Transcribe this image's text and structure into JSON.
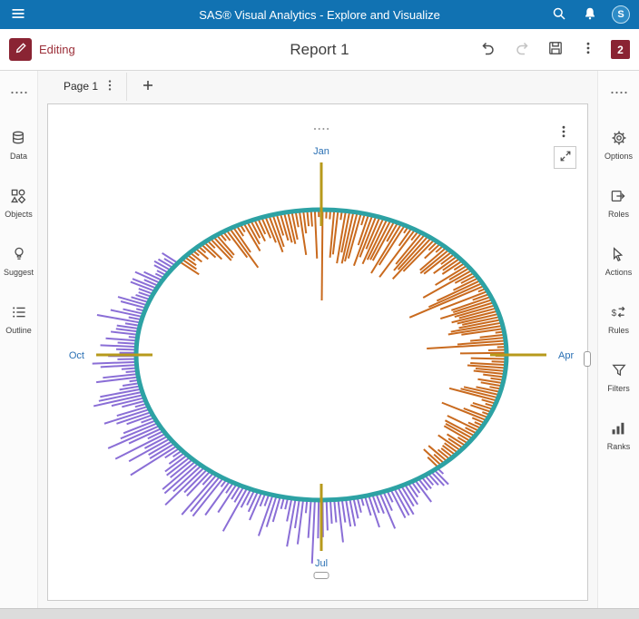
{
  "colors": {
    "header_bg": "#1172B2",
    "accent": "#8A2433",
    "editing_text": "#9C2F39"
  },
  "header": {
    "title": "SAS® Visual Analytics - Explore and Visualize",
    "avatar_initial": "S"
  },
  "toolbar": {
    "mode_label": "Editing",
    "report_title": "Report 1",
    "badge_count": "2"
  },
  "tabs": {
    "active_label": "Page 1"
  },
  "left_rail": {
    "items": [
      {
        "label": "Data"
      },
      {
        "label": "Objects"
      },
      {
        "label": "Suggest"
      },
      {
        "label": "Outline"
      }
    ]
  },
  "right_rail": {
    "items": [
      {
        "label": "Options"
      },
      {
        "label": "Roles"
      },
      {
        "label": "Actions"
      },
      {
        "label": "Rules"
      },
      {
        "label": "Filters"
      },
      {
        "label": "Ranks"
      }
    ]
  },
  "chart_data": {
    "type": "radial_bar",
    "description": "Dense daily values drawn as radial bars around an elliptical ring; upper-half bars (approx. Nov through mid-May) point inward in orange, lower-half bars (mid-May through Oct) point outward in purple. Olive axis lines with blue month labels at Jan (top), Apr (right), Jul (bottom), Oct (left).",
    "axis_labels": [
      {
        "label": "Jan",
        "angle_deg": 0
      },
      {
        "label": "Apr",
        "angle_deg": 90
      },
      {
        "label": "Jul",
        "angle_deg": 180
      },
      {
        "label": "Oct",
        "angle_deg": 270
      }
    ],
    "ring_color": "#2DA2A4",
    "axis_line_color": "#B79A1C",
    "axis_label_color": "#2A70B4",
    "bar_step_deg": 1.2,
    "series": [
      {
        "name": "inward-bars",
        "color": "#C96A1E",
        "direction": "inward",
        "angle_start_deg": -50,
        "angle_end_deg": 141
      },
      {
        "name": "outward-bars",
        "color": "#8A6ED6",
        "direction": "outward",
        "angle_start_deg": 141.2,
        "angle_end_deg": 310
      }
    ]
  }
}
